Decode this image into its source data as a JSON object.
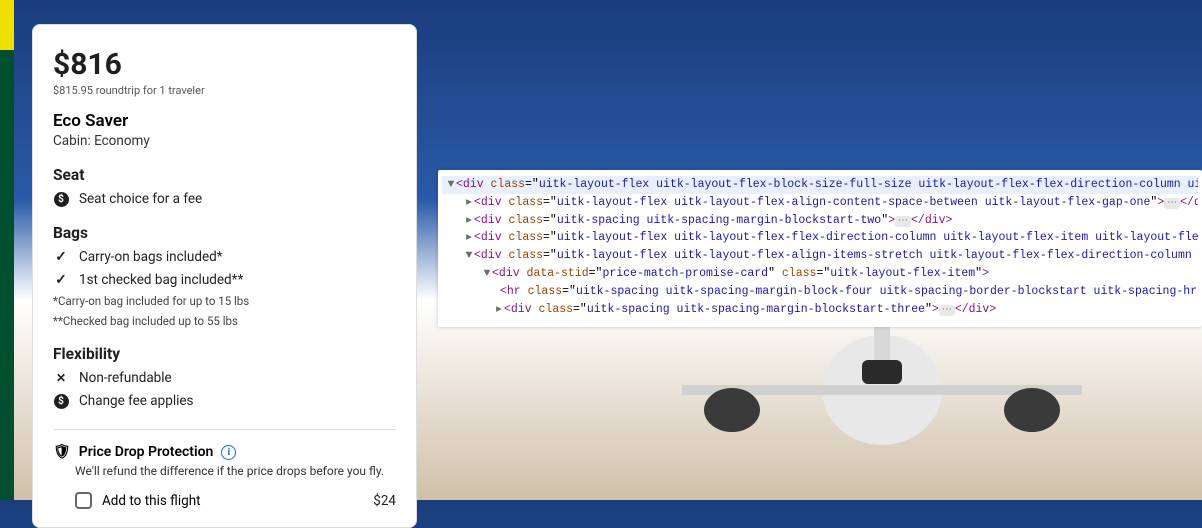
{
  "price": {
    "amount": "$816",
    "subtext": "$815.95 roundtrip for 1 traveler"
  },
  "fare": {
    "name": "Eco Saver",
    "cabin": "Cabin: Economy"
  },
  "seat": {
    "title": "Seat",
    "choice": "Seat choice for a fee"
  },
  "bags": {
    "title": "Bags",
    "carryon": "Carry-on bags included*",
    "checked": "1st checked bag included**",
    "note1": "*Carry-on bag included for up to 15 lbs",
    "note2": "**Checked bag included up to 55 lbs"
  },
  "flex": {
    "title": "Flexibility",
    "nonref": "Non-refundable",
    "changefee": "Change fee applies"
  },
  "pdp": {
    "title": "Price Drop Protection",
    "desc": "We'll refund the difference if the price drops before you fly.",
    "add_label": "Add to this flight",
    "price": "$24"
  },
  "devtools": {
    "l1_class": "uitk-layout-flex uitk-layout-flex-block-size-full-size uitk-layout-flex-flex-direction-column uitk-spacing",
    "l2_class": "uitk-layout-flex uitk-layout-flex-align-content-space-between uitk-layout-flex-gap-one",
    "l3_class": "uitk-spacing uitk-spacing-margin-blockstart-two",
    "l4_class": "uitk-layout-flex uitk-layout-flex-flex-direction-column uitk-layout-flex-item uitk-layout-flex-item-flex-g",
    "l5_class": "uitk-layout-flex uitk-layout-flex-align-items-stretch uitk-layout-flex-flex-direction-column uitk-layout-f",
    "l6_stid": "price-match-promise-card",
    "l6_class": "uitk-layout-flex-item",
    "l7_class": "uitk-spacing uitk-spacing-margin-block-four uitk-spacing-border-blockstart uitk-spacing-hr",
    "l8_class": "uitk-spacing uitk-spacing-margin-blockstart-three"
  }
}
